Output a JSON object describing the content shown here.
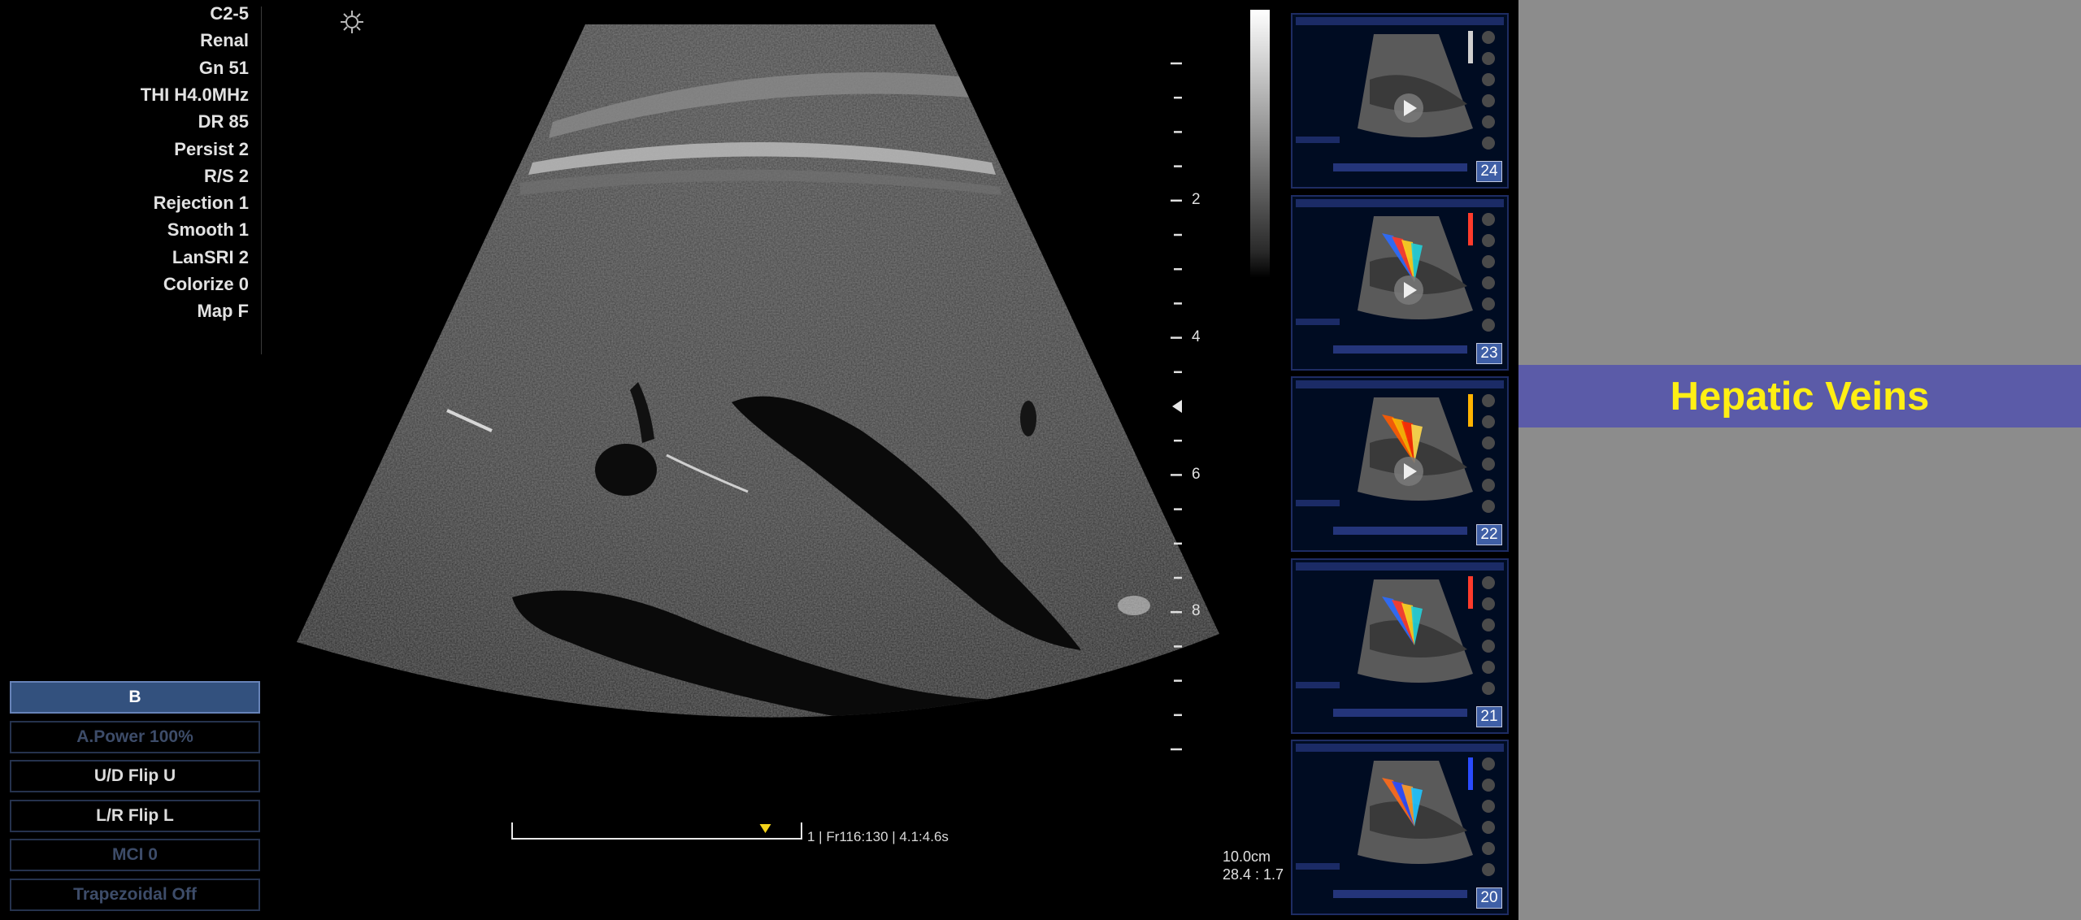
{
  "params": [
    "C2-5",
    "Renal",
    "Gn 51",
    "THI H4.0MHz",
    "DR 85",
    "Persist 2",
    "R/S 2",
    "Rejection 1",
    "Smooth 1",
    "LanSRI 2",
    "Colorize 0",
    "Map F"
  ],
  "controls": [
    {
      "label": "B",
      "state": "active"
    },
    {
      "label": "A.Power 100%",
      "state": "dim"
    },
    {
      "label": "U/D Flip  U",
      "state": "normal"
    },
    {
      "label": "L/R Flip  L",
      "state": "normal"
    },
    {
      "label": "MCI 0",
      "state": "dim"
    },
    {
      "label": "Trapezoidal  Off",
      "state": "dim"
    }
  ],
  "depth_scale": {
    "labels": [
      "2",
      "4",
      "6",
      "8"
    ]
  },
  "timeline": {
    "label": "1 | Fr116:130 | 4.1:4.6s",
    "cursor_fraction": 0.88
  },
  "depth_info": {
    "depth": "10.0cm",
    "ratio": "28.4 : 1.7"
  },
  "thumbnails": [
    {
      "number": "24",
      "mode": "b-mode"
    },
    {
      "number": "23",
      "mode": "color"
    },
    {
      "number": "22",
      "mode": "power"
    },
    {
      "number": "21",
      "mode": "color"
    },
    {
      "number": "20",
      "mode": "color-venous"
    }
  ],
  "banner": {
    "title": "Hepatic Veins"
  },
  "colors": {
    "banner_bg": "#5b5ba8",
    "banner_text": "#ffef14",
    "right_panel_bg": "#8c8c8c",
    "active_control": "#33517e"
  }
}
